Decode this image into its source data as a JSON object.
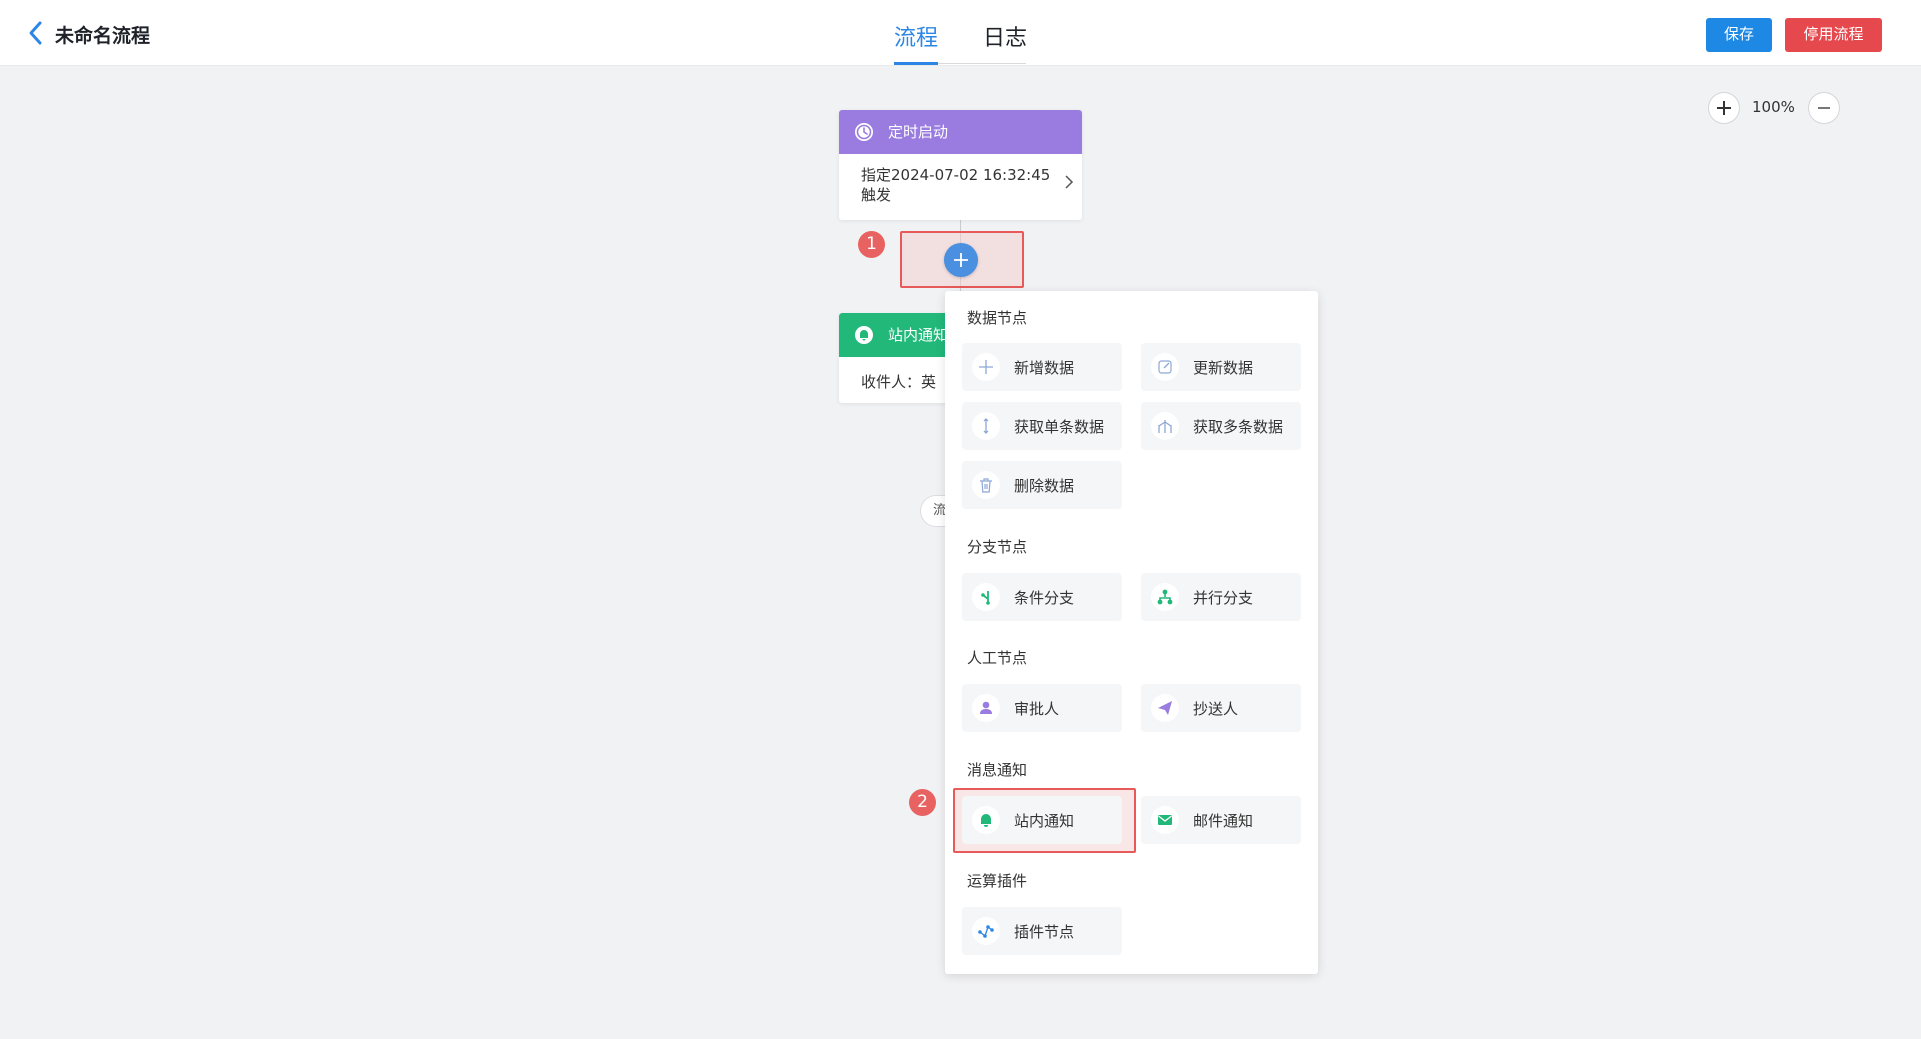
{
  "header": {
    "title": "未命名流程",
    "tabs": [
      {
        "label": "流程",
        "active": true
      },
      {
        "label": "日志",
        "active": false
      }
    ],
    "save_label": "保存",
    "stop_label": "停用流程",
    "colors": {
      "primary": "#1e88e5",
      "danger": "#e5484d"
    }
  },
  "zoom": {
    "level": "100%"
  },
  "flow": {
    "start_node": {
      "title": "定时启动",
      "body": "指定2024-07-02 16:32:45触发",
      "color": "#9a7be0"
    },
    "notify_node": {
      "title": "站内通知",
      "body": "收件人：英",
      "color": "#21b87a"
    },
    "partial_pill": "流",
    "markers": [
      "1",
      "2"
    ]
  },
  "menu": {
    "sections": [
      {
        "label": "数据节点",
        "items": [
          "新增数据",
          "更新数据",
          "获取单条数据",
          "获取多条数据",
          "删除数据"
        ]
      },
      {
        "label": "分支节点",
        "items": [
          "条件分支",
          "并行分支"
        ]
      },
      {
        "label": "人工节点",
        "items": [
          "审批人",
          "抄送人"
        ]
      },
      {
        "label": "消息通知",
        "items": [
          "站内通知",
          "邮件通知"
        ]
      },
      {
        "label": "运算插件",
        "items": [
          "插件节点"
        ]
      }
    ]
  }
}
